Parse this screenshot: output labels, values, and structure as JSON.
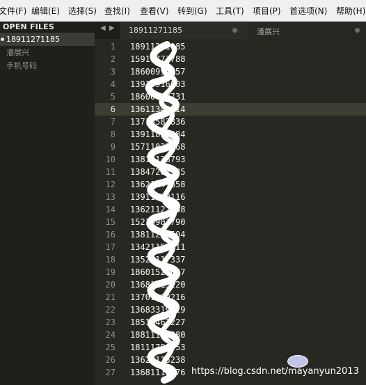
{
  "menu": [
    "文件(F)",
    "编辑(E)",
    "选择(S)",
    "查找(I)",
    "查看(V)",
    "转到(G)",
    "工具(T)",
    "项目(P)",
    "首选项(N)",
    "帮助(H)"
  ],
  "sidebar": {
    "header": "OPEN FILES",
    "files": [
      {
        "label": "18911271185",
        "active": true
      },
      {
        "label": "潘展兴",
        "active": false
      },
      {
        "label": "手机号码",
        "active": false
      }
    ]
  },
  "tabs": [
    {
      "label": "18911271185",
      "active": true
    },
    {
      "label": "潘展兴",
      "active": false
    }
  ],
  "tab_nav": {
    "prev_icon": "triangle-left",
    "next_icon": "triangle-right"
  },
  "editor": {
    "current_line": 6,
    "lines": [
      "18911271185",
      "15910773788",
      "18600915357",
      "13910916003",
      "18600708731",
      "13611343014",
      "13718583836",
      "13911874084",
      "15711037968",
      "13811138793",
      "13847201985",
      "13621147858",
      "13911529116",
      "13621127858",
      "15210901790",
      "13811209504",
      "13421152011",
      "13521117337",
      "18601520667",
      "13681113220",
      "13701109216",
      "13683319319",
      "18511462227",
      "18811163080",
      "18111788953",
      "13621115238",
      "13681112276"
    ]
  },
  "watermark": "https://blog.csdn.net/mayanyun2013",
  "colors": {
    "editor_bg": "#272822",
    "sidebar_bg": "#1f201b",
    "menu_bg": "#f0f0f0",
    "scribble": "#ffffff"
  }
}
